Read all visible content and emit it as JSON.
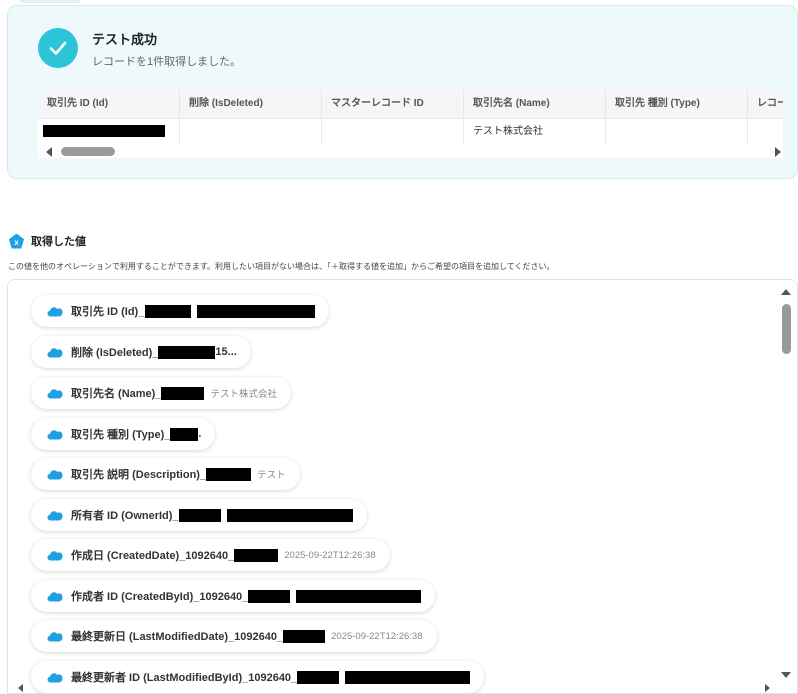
{
  "result": {
    "title": "テスト成功",
    "subtitle": "レコードを1件取得しました。"
  },
  "table": {
    "headers": [
      "取引先 ID (Id)",
      "削除 (IsDeleted)",
      "マスターレコード ID",
      "取引先名 (Name)",
      "取引先 種別 (Type)",
      "レコー"
    ],
    "row": [
      "",
      "",
      "",
      "テスト株式会社",
      "",
      ""
    ]
  },
  "section": {
    "title": "取得した値",
    "badge": "x",
    "description": "この値を他のオペレーションで利用することができます。利用したい項目がない場合は、「＋取得する値を追加」からご希望の項目を追加してください。"
  },
  "values": [
    {
      "label": "取引先 ID (Id)_",
      "value": "",
      "suffix": ""
    },
    {
      "label": "削除 (IsDeleted)_",
      "value": "",
      "suffix": "15..."
    },
    {
      "label": "取引先名 (Name)_",
      "value": "テスト株式会社",
      "suffix": ""
    },
    {
      "label": "取引先 種別 (Type)_",
      "value": "",
      "suffix": "."
    },
    {
      "label": "取引先 説明 (Description)_",
      "value": "テスト",
      "suffix": ""
    },
    {
      "label": "所有者 ID (OwnerId)_",
      "value": "",
      "suffix": ""
    },
    {
      "label": "作成日 (CreatedDate)_1092640_",
      "value": "2025-09-22T12:26:38",
      "suffix": ""
    },
    {
      "label": "作成者 ID (CreatedById)_1092640_",
      "value": "",
      "suffix": ""
    },
    {
      "label": "最終更新日 (LastModifiedDate)_1092640_",
      "value": "2025-09-22T12:26:38",
      "suffix": ""
    },
    {
      "label": "最終更新者 ID (LastModifiedById)_1092640_",
      "value": "",
      "suffix": ""
    }
  ],
  "icons": {
    "success": "check-icon",
    "value_source": "salesforce-cloud-icon",
    "section": "x-badge-icon"
  },
  "colors": {
    "accent": "#2ec4d8",
    "card_bg": "#edf9fb",
    "salesforce": "#1da1e2"
  }
}
